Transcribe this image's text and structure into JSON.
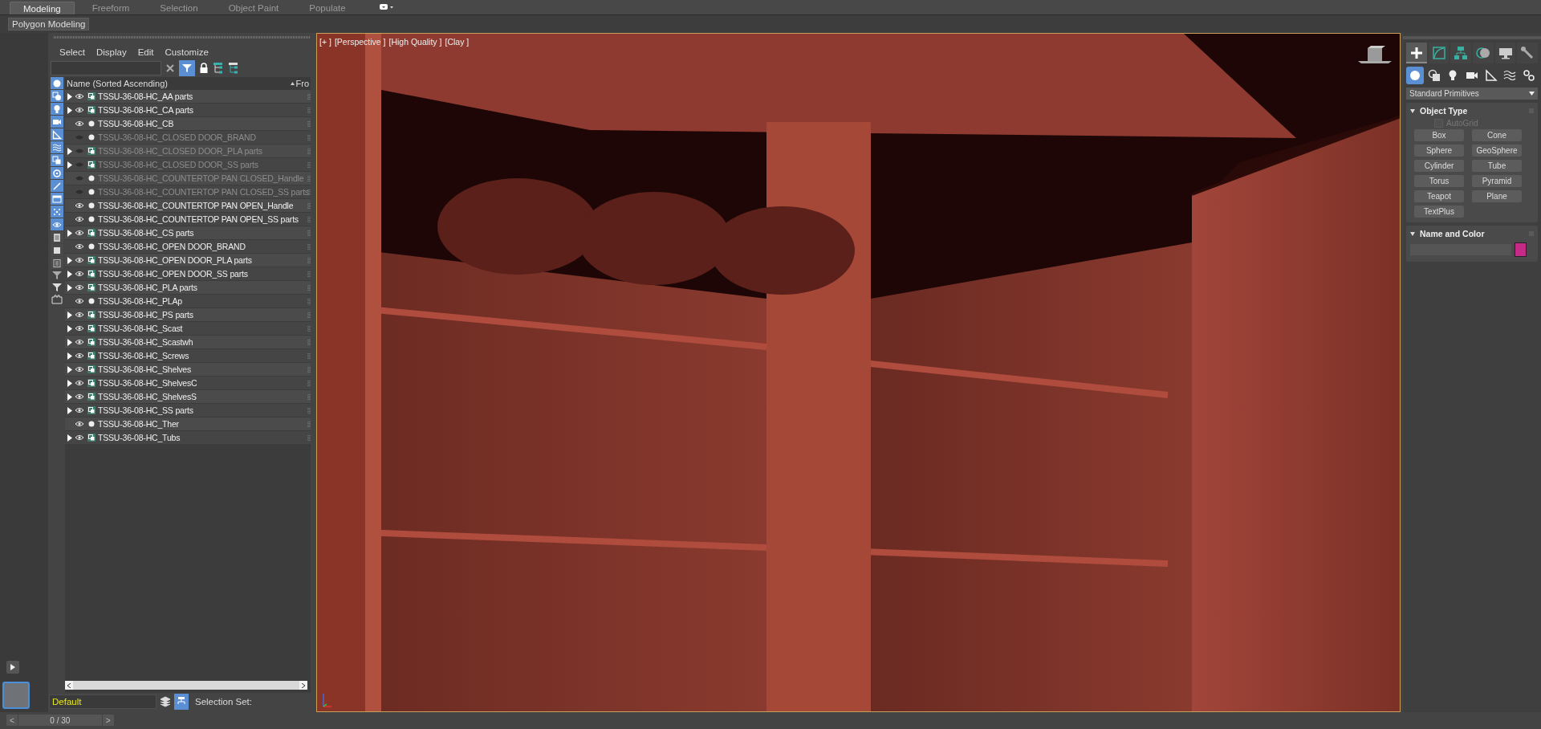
{
  "ribbon": {
    "tabs": [
      {
        "label": "Modeling",
        "selected": true
      },
      {
        "label": "Freeform",
        "selected": false
      },
      {
        "label": "Selection",
        "selected": false
      },
      {
        "label": "Object Paint",
        "selected": false
      },
      {
        "label": "Populate",
        "selected": false
      }
    ],
    "panel": "Polygon Modeling"
  },
  "scene_explorer": {
    "menus": [
      "Select",
      "Display",
      "Edit",
      "Customize"
    ],
    "filter_button": {
      "selected": true
    },
    "filters": [
      {
        "kind": "geometry",
        "on": true
      },
      {
        "kind": "shapes",
        "on": true
      },
      {
        "kind": "lights",
        "on": true
      },
      {
        "kind": "cameras",
        "on": true
      },
      {
        "kind": "helpers",
        "on": true
      },
      {
        "kind": "spacewarps",
        "on": true
      },
      {
        "kind": "groups",
        "on": true
      },
      {
        "kind": "xrefs",
        "on": true
      },
      {
        "kind": "bones",
        "on": true
      },
      {
        "kind": "containers",
        "on": true
      },
      {
        "kind": "particles",
        "on": true
      },
      {
        "kind": "hidden",
        "on": true
      },
      {
        "kind": "frozen",
        "on": false
      },
      {
        "kind": "solid",
        "on": false
      },
      {
        "kind": "list",
        "on": false
      }
    ],
    "columns": [
      "Name (Sorted Ascending)",
      "Fro"
    ],
    "rows": [
      {
        "name": "TSSU-36-08-HC_AA parts",
        "visible": true,
        "kind": "group"
      },
      {
        "name": "TSSU-36-08-HC_CA parts",
        "visible": true,
        "kind": "group"
      },
      {
        "name": "TSSU-36-08-HC_CB",
        "visible": true,
        "kind": "object"
      },
      {
        "name": "TSSU-36-08-HC_CLOSED DOOR_BRAND",
        "visible": false,
        "kind": "object"
      },
      {
        "name": "TSSU-36-08-HC_CLOSED DOOR_PLA parts",
        "visible": false,
        "kind": "group"
      },
      {
        "name": "TSSU-36-08-HC_CLOSED DOOR_SS parts",
        "visible": false,
        "kind": "group"
      },
      {
        "name": "TSSU-36-08-HC_COUNTERTOP PAN CLOSED_Handle",
        "visible": false,
        "kind": "object"
      },
      {
        "name": "TSSU-36-08-HC_COUNTERTOP PAN CLOSED_SS parts",
        "visible": false,
        "kind": "object"
      },
      {
        "name": "TSSU-36-08-HC_COUNTERTOP PAN OPEN_Handle",
        "visible": true,
        "kind": "object"
      },
      {
        "name": "TSSU-36-08-HC_COUNTERTOP PAN OPEN_SS parts",
        "visible": true,
        "kind": "object"
      },
      {
        "name": "TSSU-36-08-HC_CS parts",
        "visible": true,
        "kind": "group"
      },
      {
        "name": "TSSU-36-08-HC_OPEN DOOR_BRAND",
        "visible": true,
        "kind": "object"
      },
      {
        "name": "TSSU-36-08-HC_OPEN DOOR_PLA parts",
        "visible": true,
        "kind": "group"
      },
      {
        "name": "TSSU-36-08-HC_OPEN DOOR_SS parts",
        "visible": true,
        "kind": "group"
      },
      {
        "name": "TSSU-36-08-HC_PLA parts",
        "visible": true,
        "kind": "group"
      },
      {
        "name": "TSSU-36-08-HC_PLAp",
        "visible": true,
        "kind": "object"
      },
      {
        "name": "TSSU-36-08-HC_PS parts",
        "visible": true,
        "kind": "group"
      },
      {
        "name": "TSSU-36-08-HC_Scast",
        "visible": true,
        "kind": "group"
      },
      {
        "name": "TSSU-36-08-HC_Scastwh",
        "visible": true,
        "kind": "group"
      },
      {
        "name": "TSSU-36-08-HC_Screws",
        "visible": true,
        "kind": "group"
      },
      {
        "name": "TSSU-36-08-HC_Shelves",
        "visible": true,
        "kind": "group"
      },
      {
        "name": "TSSU-36-08-HC_ShelvesC",
        "visible": true,
        "kind": "group"
      },
      {
        "name": "TSSU-36-08-HC_ShelvesS",
        "visible": true,
        "kind": "group"
      },
      {
        "name": "TSSU-36-08-HC_SS parts",
        "visible": true,
        "kind": "group"
      },
      {
        "name": "TSSU-36-08-HC_Ther",
        "visible": true,
        "kind": "object"
      },
      {
        "name": "TSSU-36-08-HC_Tubs",
        "visible": true,
        "kind": "group"
      }
    ],
    "layer": "Default",
    "selection_set_label": "Selection Set:"
  },
  "viewport": {
    "labels": [
      "[+ ]",
      "[Perspective ]",
      "[High Quality ]",
      "[Clay ]"
    ]
  },
  "command_panel": {
    "tabs": [
      {
        "kind": "create",
        "selected": true
      },
      {
        "kind": "modify",
        "selected": false
      },
      {
        "kind": "hierarchy",
        "selected": false
      },
      {
        "kind": "motion",
        "selected": false
      },
      {
        "kind": "display",
        "selected": false
      },
      {
        "kind": "utilities",
        "selected": false
      }
    ],
    "subtabs": [
      {
        "kind": "geometry",
        "selected": true
      },
      {
        "kind": "shapes",
        "selected": false
      },
      {
        "kind": "lights",
        "selected": false
      },
      {
        "kind": "cameras",
        "selected": false
      },
      {
        "kind": "helpers",
        "selected": false
      },
      {
        "kind": "spacewarps",
        "selected": false
      },
      {
        "kind": "systems",
        "selected": false
      }
    ],
    "category": "Standard Primitives",
    "object_type": {
      "title": "Object Type",
      "autogrid": {
        "label": "AutoGrid",
        "checked": false,
        "disabled": true
      },
      "buttons": [
        "Box",
        "Cone",
        "Sphere",
        "GeoSphere",
        "Cylinder",
        "Tube",
        "Torus",
        "Pyramid",
        "Teapot",
        "Plane",
        "TextPlus"
      ]
    },
    "name_and_color": {
      "title": "Name and Color",
      "color": "#c42a86"
    }
  },
  "time_slider": {
    "frame": "0 / 30",
    "level": 0,
    "prev": "<",
    "next": ">"
  }
}
